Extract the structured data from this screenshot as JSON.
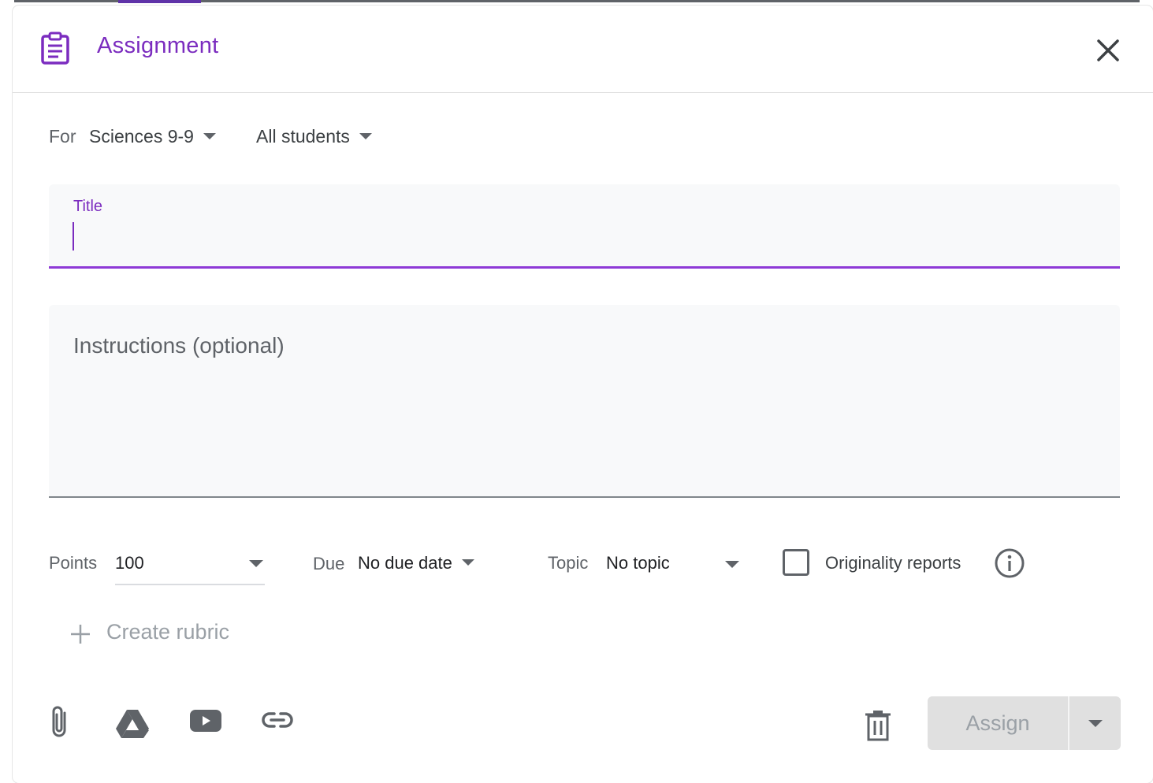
{
  "header": {
    "title": "Assignment",
    "icon": "assignment-icon",
    "close_icon": "close-icon"
  },
  "for_row": {
    "label": "For",
    "class": "Sciences 9-9",
    "students": "All students"
  },
  "title_field": {
    "label": "Title",
    "value": ""
  },
  "instructions_field": {
    "placeholder": "Instructions (optional)",
    "value": ""
  },
  "options": {
    "points_label": "Points",
    "points_value": "100",
    "due_label": "Due",
    "due_value": "No due date",
    "topic_label": "Topic",
    "topic_value": "No topic",
    "originality_label": "Originality reports",
    "originality_checked": false
  },
  "rubric": {
    "label": "Create rubric"
  },
  "footer": {
    "icons": [
      "attach-icon",
      "drive-icon",
      "youtube-icon",
      "link-icon"
    ],
    "assign_label": "Assign"
  },
  "colors": {
    "accent": "#7b2cbf",
    "title_underline": "#8e3ad6",
    "field_bg": "#f8f9fa",
    "disabled_button": "#e0e0e0"
  }
}
